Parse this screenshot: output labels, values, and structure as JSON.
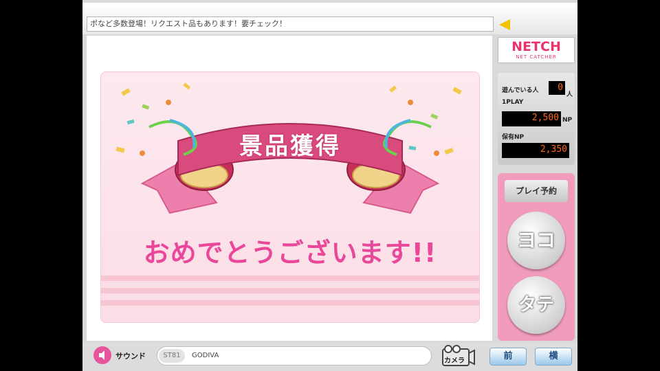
{
  "ticker": {
    "text": "ポなど多数登場！リクエスト品もあります！要チェック！"
  },
  "prize_screen": {
    "banner_title": "景品獲得",
    "message": "おめでとうございます!!"
  },
  "logo": {
    "main": "NETCH",
    "sub": "NET CATCHER"
  },
  "info": {
    "playing_label": "遊んでいる人",
    "playing_count": "0",
    "playing_unit": "人",
    "play_cost_label": "1PLAY",
    "play_cost": "2,500",
    "play_cost_unit": "NP",
    "owned_label": "保有NP",
    "owned": "2,350"
  },
  "controls": {
    "reserve_label": "プレイ予約",
    "yoko_label": "ヨコ",
    "tate_label": "タテ"
  },
  "bottom": {
    "sound_label": "サウンド",
    "prize_code": "ST81",
    "prize_name": "GODIVA",
    "camera_label": "カメラ",
    "front_label": "前",
    "side_label": "横"
  },
  "colors": {
    "accent_pink": "#e9479a",
    "led_orange": "#ff6a1a",
    "control_pink": "#f19bbd"
  }
}
